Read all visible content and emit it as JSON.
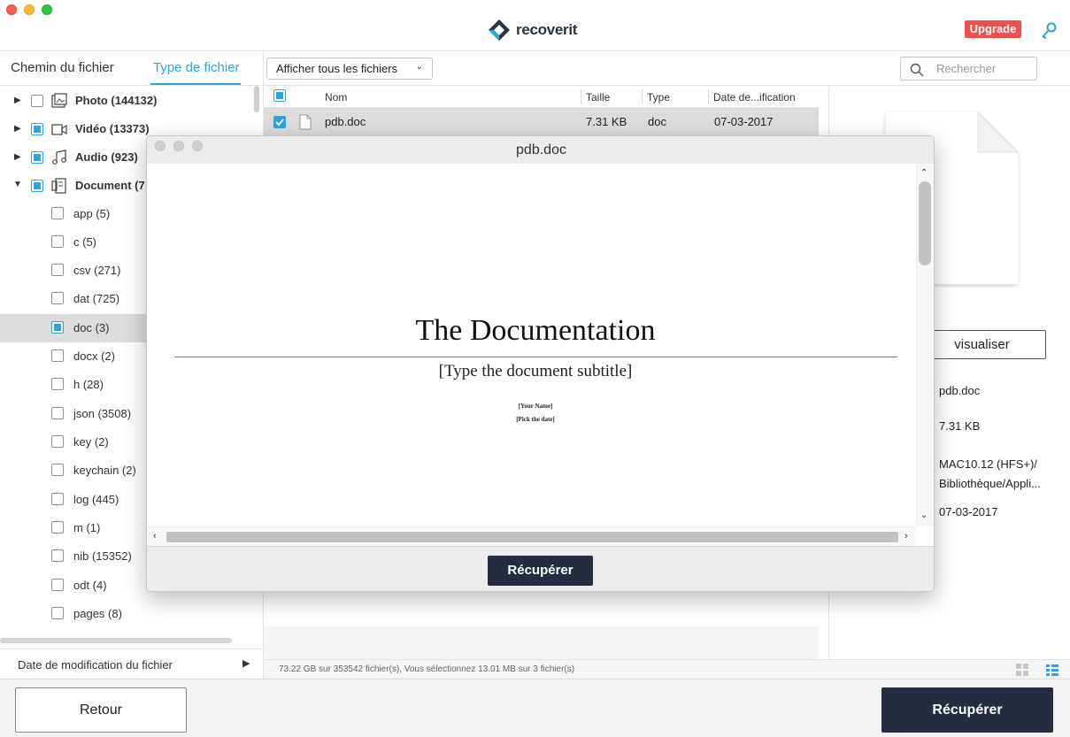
{
  "app": {
    "brand": "recoverit",
    "upgrade_label": "Upgrade",
    "accent_color": "#2aa6dc",
    "dark_button_color": "#252c40",
    "upgrade_color": "#f0504d"
  },
  "sidebar": {
    "tabs": [
      {
        "label": "Chemin du fichier",
        "active": false
      },
      {
        "label": "Type de fichier",
        "active": true
      }
    ],
    "categories": [
      {
        "label": "Photo (144132)",
        "icon": "photo-icon",
        "checked": "none",
        "expanded": false
      },
      {
        "label": "Vidéo (13373)",
        "icon": "video-icon",
        "checked": "partial",
        "expanded": false
      },
      {
        "label": "Audio (923)",
        "icon": "audio-icon",
        "checked": "partial",
        "expanded": false
      },
      {
        "label": "Document (7",
        "icon": "document-icon",
        "checked": "partial",
        "expanded": true
      }
    ],
    "subtypes": [
      {
        "label": "app (5)",
        "checked": "none"
      },
      {
        "label": "c (5)",
        "checked": "none"
      },
      {
        "label": "csv (271)",
        "checked": "none"
      },
      {
        "label": "dat (725)",
        "checked": "none"
      },
      {
        "label": "doc (3)",
        "checked": "partial",
        "selected": true
      },
      {
        "label": "docx (2)",
        "checked": "none"
      },
      {
        "label": "h (28)",
        "checked": "none"
      },
      {
        "label": "json (3508)",
        "checked": "none"
      },
      {
        "label": "key (2)",
        "checked": "none"
      },
      {
        "label": "keychain (2)",
        "checked": "none"
      },
      {
        "label": "log (445)",
        "checked": "none"
      },
      {
        "label": "m (1)",
        "checked": "none"
      },
      {
        "label": "nib (15352)",
        "checked": "none"
      },
      {
        "label": "odt (4)",
        "checked": "none"
      },
      {
        "label": "pages (8)",
        "checked": "none"
      }
    ],
    "date_filter_label": "Date de modification du fichier"
  },
  "toolbar": {
    "filter_label": "Afficher tous les fichiers",
    "search_placeholder": "Rechercher"
  },
  "file_list": {
    "columns": [
      "Nom",
      "Taille",
      "Type",
      "Date de...ification"
    ],
    "rows": [
      {
        "name": "pdb.doc",
        "size": "7.31 KB",
        "type": "doc",
        "date": "07-03-2017",
        "checked": true
      }
    ]
  },
  "detail": {
    "preview_button": "visualiser",
    "name": "pdb.doc",
    "size": "7.31 KB",
    "path_line1": "MAC10.12 (HFS+)/",
    "path_line2": "Bibliothèque/Appli...",
    "date": "07-03-2017"
  },
  "status": {
    "text": "73.22 GB sur 353542 fichier(s), Vous sélectionnez 13.01 MB sur 3 fichier(s)"
  },
  "bottom": {
    "back_label": "Retour",
    "recover_label": "Récupérer"
  },
  "modal": {
    "title": "pdb.doc",
    "doc_title": "The Documentation",
    "doc_subtitle": "[Type the document subtitle]",
    "doc_author": "[Your Name]",
    "doc_date": "[Pick the date]",
    "recover_label": "Récupérer"
  }
}
